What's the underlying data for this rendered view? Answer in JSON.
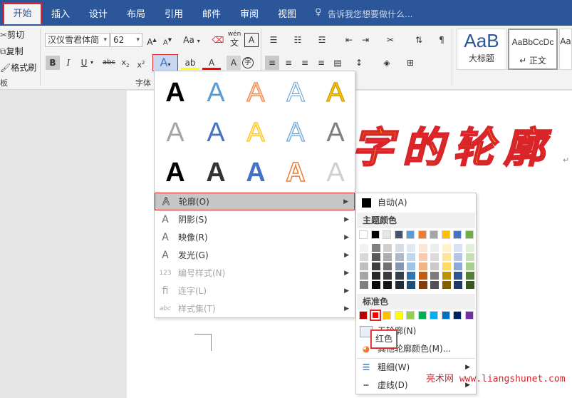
{
  "tabs": [
    "开始",
    "插入",
    "设计",
    "布局",
    "引用",
    "邮件",
    "审阅",
    "视图"
  ],
  "tellme": "告诉我您想要做什么...",
  "clipboard": {
    "cut": "剪切",
    "copy": "复制",
    "format_painter": "格式刷",
    "group": "板"
  },
  "font": {
    "name": "汉仪雪君体简",
    "size": "62",
    "group": "字体",
    "aa_label": "Aa",
    "wen": "wén",
    "wen_char": "文",
    "A_box": "A"
  },
  "styles": {
    "items": [
      {
        "preview": "AaB",
        "label": "大标题"
      },
      {
        "preview": "AaBbCcDc",
        "label": "↵ 正文"
      },
      {
        "preview": "Aa",
        "label": ""
      }
    ]
  },
  "doc_text": [
    "字",
    "的",
    "轮",
    "廓"
  ],
  "menu": {
    "items": [
      {
        "label": "轮廓(O)",
        "icon": "outline-A-icon",
        "disabled": false,
        "selected": true,
        "glyph": "A"
      },
      {
        "label": "阴影(S)",
        "icon": "shadow-A-icon",
        "disabled": false,
        "selected": false,
        "glyph": "A"
      },
      {
        "label": "映像(R)",
        "icon": "reflection-A-icon",
        "disabled": false,
        "selected": false,
        "glyph": "A"
      },
      {
        "label": "发光(G)",
        "icon": "glow-A-icon",
        "disabled": false,
        "selected": false,
        "glyph": "A"
      },
      {
        "label": "编号样式(N)",
        "icon": "number-style-icon",
        "disabled": true,
        "selected": false,
        "glyph": "123"
      },
      {
        "label": "连字(L)",
        "icon": "ligature-icon",
        "disabled": true,
        "selected": false,
        "glyph": "fi"
      },
      {
        "label": "样式集(T)",
        "icon": "stylistic-set-icon",
        "disabled": true,
        "selected": false,
        "glyph": "abc"
      }
    ]
  },
  "outline": {
    "automatic": "自动(A)",
    "theme_colors": "主题颜色",
    "standard_colors": "标准色",
    "no_outline": "无轮廓(N)",
    "more": "其他轮廓颜色(M)...",
    "weight": "粗细(W)",
    "dashes": "虚线(D)",
    "tooltip": "红色",
    "theme_base": [
      "#ffffff",
      "#000000",
      "#e7e6e6",
      "#44546a",
      "#5b9bd5",
      "#ed7d31",
      "#a5a5a5",
      "#ffc000",
      "#4472c4",
      "#70ad47"
    ],
    "theme_shades": [
      [
        "#f2f2f2",
        "#7f7f7f",
        "#d0cece",
        "#d6dce4",
        "#deebf6",
        "#fbe5d5",
        "#ededed",
        "#fff2cc",
        "#d9e2f3",
        "#e2efd9"
      ],
      [
        "#d8d8d8",
        "#595959",
        "#aeabab",
        "#adb9ca",
        "#bdd7ee",
        "#f7cbac",
        "#dbdbdb",
        "#fee599",
        "#b4c6e7",
        "#c5e0b3"
      ],
      [
        "#bfbfbf",
        "#3f3f3f",
        "#757070",
        "#8496b0",
        "#9dc3e6",
        "#f4b183",
        "#c9c9c9",
        "#ffd965",
        "#8eaadb",
        "#a8d08d"
      ],
      [
        "#a5a5a5",
        "#262626",
        "#3a3838",
        "#323f4f",
        "#2e75b5",
        "#c55a11",
        "#7b7b7b",
        "#bf9000",
        "#2f5496",
        "#538135"
      ],
      [
        "#7f7f7f",
        "#0c0c0c",
        "#171616",
        "#222a35",
        "#1f4e79",
        "#833c0b",
        "#525252",
        "#7f6000",
        "#1f3864",
        "#375623"
      ]
    ],
    "standard": [
      "#c00000",
      "#ff0000",
      "#ffc000",
      "#ffff00",
      "#92d050",
      "#00b050",
      "#00b0f0",
      "#0070c0",
      "#002060",
      "#7030a0"
    ]
  },
  "watermark": "亮术网 www.liangshunet.com"
}
